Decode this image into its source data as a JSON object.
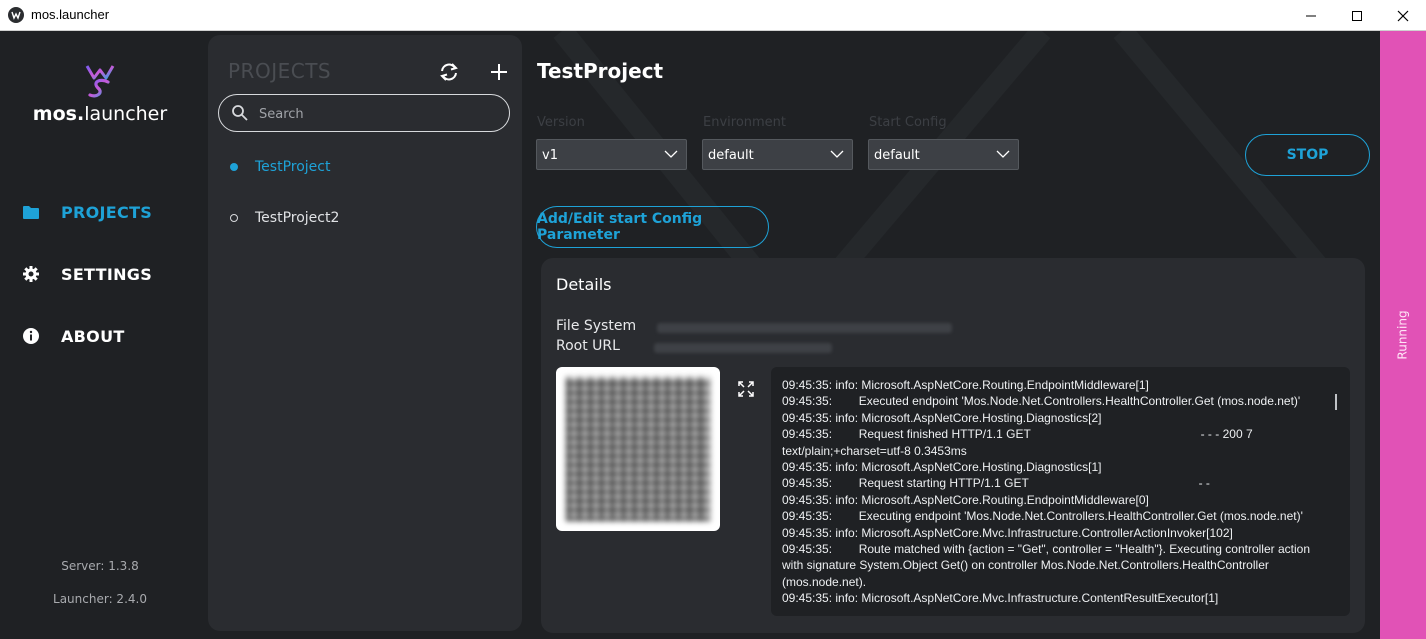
{
  "window": {
    "title": "mos.launcher"
  },
  "nav": {
    "logo_bold": "mos.",
    "logo_light": "launcher",
    "items": [
      {
        "label": "PROJECTS",
        "icon": "folder-icon",
        "active": true
      },
      {
        "label": "SETTINGS",
        "icon": "gear-icon",
        "active": false
      },
      {
        "label": "ABOUT",
        "icon": "info-icon",
        "active": false
      }
    ],
    "server_version": "Server: 1.3.8",
    "launcher_version": "Launcher: 2.4.0"
  },
  "projects_panel": {
    "title": "PROJECTS",
    "search_placeholder": "Search",
    "items": [
      {
        "name": "TestProject",
        "active": true
      },
      {
        "name": "TestProject2",
        "active": false
      }
    ]
  },
  "main": {
    "project_title": "TestProject",
    "version": {
      "label": "Version",
      "value": "v1"
    },
    "environment": {
      "label": "Environment",
      "value": "default"
    },
    "start_config": {
      "label": "Start Config",
      "value": "default"
    },
    "stop_label": "STOP",
    "config_button_label": "Add/Edit start Config Parameter",
    "details": {
      "title": "Details",
      "file_system_label": "File System",
      "root_url_label": "Root URL"
    },
    "log_lines": [
      "09:45:35: info: Microsoft.AspNetCore.Routing.EndpointMiddleware[1]",
      "09:45:35:        Executed endpoint 'Mos.Node.Net.Controllers.HealthController.Get (mos.node.net)'",
      "09:45:35: info: Microsoft.AspNetCore.Hosting.Diagnostics[2]",
      "09:45:35:        Request finished HTTP/1.1 GET                                                   - - - 200 7 text/plain;+charset=utf-8 0.3453ms",
      "09:45:35: info: Microsoft.AspNetCore.Hosting.Diagnostics[1]",
      "09:45:35:        Request starting HTTP/1.1 GET                                                   - -",
      "09:45:35: info: Microsoft.AspNetCore.Routing.EndpointMiddleware[0]",
      "09:45:35:        Executing endpoint 'Mos.Node.Net.Controllers.HealthController.Get (mos.node.net)'",
      "09:45:35: info: Microsoft.AspNetCore.Mvc.Infrastructure.ControllerActionInvoker[102]",
      "09:45:35:        Route matched with {action = \"Get\", controller = \"Health\"}. Executing controller action with signature System.Object Get() on controller Mos.Node.Net.Controllers.HealthController (mos.node.net).",
      "09:45:35: info: Microsoft.AspNetCore.Mvc.Infrastructure.ContentResultExecutor[1]"
    ]
  },
  "status": {
    "label": "Running"
  },
  "colors": {
    "accent": "#1ea2d7",
    "status_running": "#e152b6",
    "panel": "#2a2c30",
    "background": "#1f2124"
  }
}
